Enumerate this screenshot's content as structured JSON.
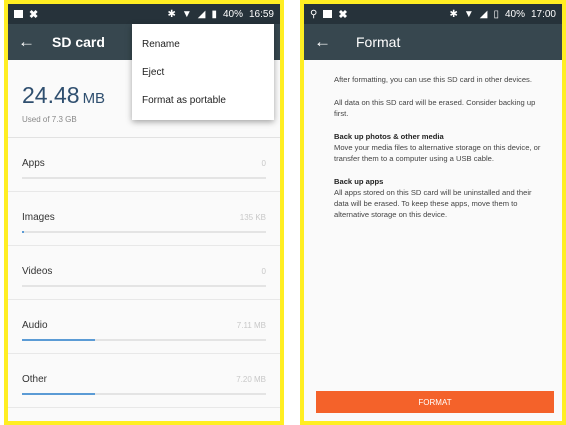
{
  "left": {
    "status": {
      "time": "16:59",
      "battery": "40%"
    },
    "appbar": {
      "title": "SD card"
    },
    "storage": {
      "size": "24.48",
      "unit": "MB",
      "used": "Used of 7.3 GB"
    },
    "categories": [
      {
        "label": "Apps",
        "value": "0",
        "fill": 0
      },
      {
        "label": "Images",
        "value": "135 KB",
        "fill": 0.01
      },
      {
        "label": "Videos",
        "value": "0",
        "fill": 0
      },
      {
        "label": "Audio",
        "value": "7.11 MB",
        "fill": 0.3
      },
      {
        "label": "Other",
        "value": "7.20 MB",
        "fill": 0.3
      }
    ],
    "menu": {
      "items": [
        "Rename",
        "Eject",
        "Format as portable"
      ]
    }
  },
  "right": {
    "status": {
      "time": "17:00",
      "battery": "40%"
    },
    "appbar": {
      "title": "Format"
    },
    "paragraphs": [
      "After formatting, you can use this SD card in other devices.",
      "All data on this SD card will be erased. Consider backing up first."
    ],
    "sections": [
      {
        "heading": "Back up photos & other media",
        "body": "Move your media files to alternative storage on this device, or transfer them to a computer using a USB cable."
      },
      {
        "heading": "Back up apps",
        "body": "All apps stored on this SD card will be uninstalled and their data will be erased. To keep these apps, move them to alternative storage on this device."
      }
    ],
    "button": "FORMAT"
  },
  "colors": {
    "appbar": "#37474f",
    "statusbar": "#26323a",
    "accent": "#f4622a",
    "frame": "#ffee22"
  }
}
